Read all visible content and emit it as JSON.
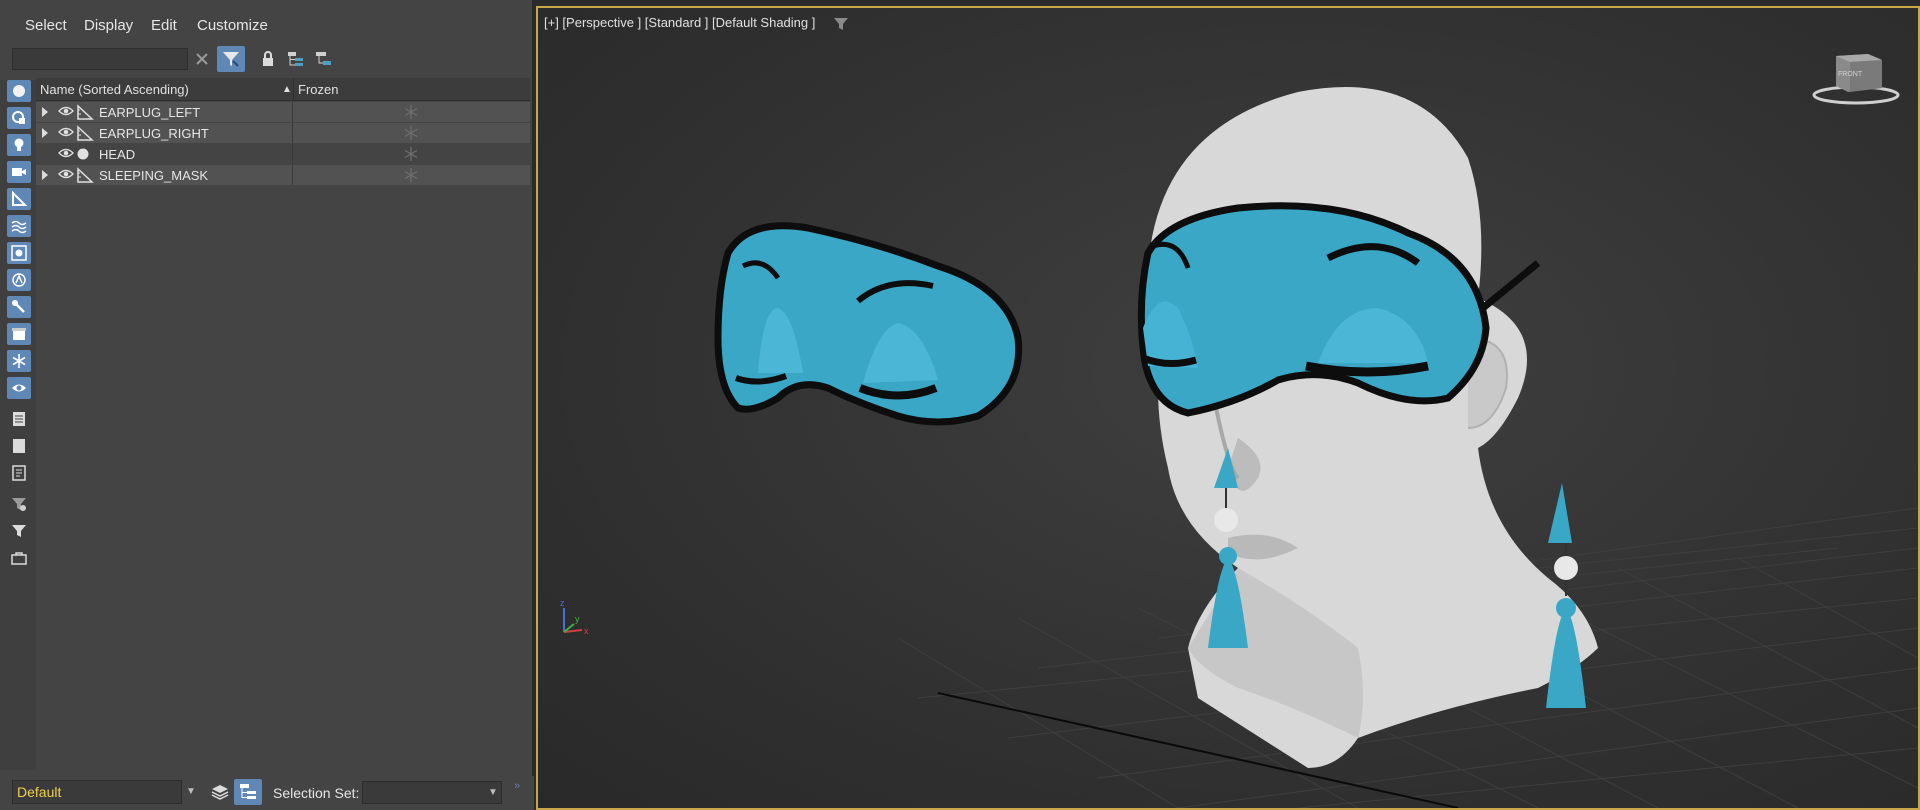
{
  "menu": {
    "select": "Select",
    "display": "Display",
    "edit": "Edit",
    "customize": "Customize"
  },
  "search": {
    "value": ""
  },
  "list": {
    "columns": {
      "name": "Name (Sorted Ascending)",
      "sort_indicator": "▲",
      "frozen": "Frozen"
    },
    "rows": [
      {
        "name": "EARPLUG_LEFT",
        "expandable": true,
        "type": "shape",
        "frozen_icon": "snowflake-icon"
      },
      {
        "name": "EARPLUG_RIGHT",
        "expandable": true,
        "type": "shape",
        "frozen_icon": "snowflake-icon"
      },
      {
        "name": "HEAD",
        "expandable": false,
        "type": "geometry",
        "frozen_icon": "snowflake-icon"
      },
      {
        "name": "SLEEPING_MASK",
        "expandable": true,
        "type": "shape",
        "frozen_icon": "snowflake-icon"
      }
    ]
  },
  "bottom": {
    "layer": "Default",
    "selection_set_label": "Selection Set:",
    "selection_set_value": ""
  },
  "viewport": {
    "label": "[+] [Perspective ] [Standard ] [Default Shading ]",
    "viewcube_face": "FRONT"
  },
  "colors": {
    "accent": "#5f88b7",
    "viewport_border": "#c9a64a",
    "mask": "#3ba7c7",
    "layer_text": "#f0d050"
  }
}
